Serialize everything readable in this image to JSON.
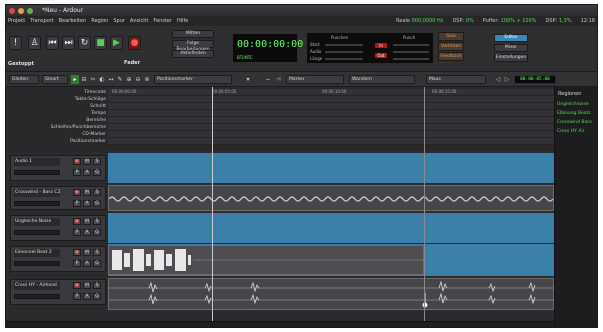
{
  "window": {
    "title": "*Neu - Ardour",
    "traffic_colors": [
      "#e0443e",
      "#e8a33c",
      "#5ab54a"
    ]
  },
  "menu": [
    "Projekt",
    "Transport",
    "Bearbeiten",
    "Region",
    "Spur",
    "Ansicht",
    "Fenster",
    "Hilfe"
  ],
  "status": {
    "items": [
      {
        "label": "Reale",
        "value": "000,0000 Hz"
      },
      {
        "label": "DSP:",
        "value": "0%"
      },
      {
        "label": "Puffer:",
        "value": "100% + 100%"
      },
      {
        "label": "DSP:",
        "value": "1,3%"
      },
      {
        "label": "",
        "value": "12:18"
      }
    ]
  },
  "transport": {
    "buttons": [
      {
        "name": "panic-button",
        "glyph": "!"
      },
      {
        "name": "metronome-button",
        "glyph": "♙"
      },
      {
        "name": "goto-start-button",
        "glyph": "⏮"
      },
      {
        "name": "goto-end-button",
        "glyph": "⏭"
      },
      {
        "name": "loop-button",
        "glyph": "↻"
      },
      {
        "name": "stop-button",
        "glyph": "■"
      },
      {
        "name": "play-button",
        "glyph": "▶"
      },
      {
        "name": "record-button",
        "glyph": "●"
      }
    ],
    "state": "Gestoppt",
    "feder": "Feder",
    "side_buttons": [
      "Mitten",
      "Folge Bearbeitungen",
      "Aktivfinden"
    ],
    "clock": "00:00:00:00",
    "clock_format": "BTI/NTC",
    "meter_headers": [
      "Punchen",
      "Punch"
    ],
    "meter_rows": [
      "Start",
      "Audio",
      "Länge"
    ],
    "meter_buttons": [
      "In",
      "Out"
    ],
    "option_buttons": [
      "Solo",
      "Vorhören",
      "Feedback"
    ],
    "view_buttons": [
      "Editor",
      "Mixer",
      "Einstellungen"
    ]
  },
  "editbar": {
    "mode1": "Gleiten",
    "mode2": "Smart",
    "snap": "Positionsmarker",
    "edit_point": "Marker",
    "nudge_label": "Wandern",
    "zoom_label": "Maus",
    "nudge_clock": "00:00:05:00"
  },
  "rulers": {
    "labels": [
      "Timecode",
      "Takte:Schläge",
      "Schnitt",
      "Tempo",
      "Bereiche",
      "Schleifen/Punchbereiche",
      "CD-Marker",
      "Positionsmarker"
    ],
    "ticks": [
      "00:00:00:00",
      "00:00:05:00",
      "00:00:10:00",
      "00:00:15:00"
    ]
  },
  "tracks": [
    {
      "name": "Audio 1",
      "type": "empty"
    },
    {
      "name": "Crosswind - Bass C2",
      "type": "wave"
    },
    {
      "name": "Ungleiche Noise",
      "type": "empty"
    },
    {
      "name": "Eileonnel Beat 2",
      "type": "beat"
    },
    {
      "name": "Cross HY - Airhead",
      "type": "sparse"
    }
  ],
  "track_buttons": [
    "●",
    "M",
    "S",
    "P",
    "A",
    "G"
  ],
  "sidebar": {
    "title": "Regionen",
    "items": [
      "Ungleichnoise",
      "Elbloung Beats",
      "Crosswind Bass",
      "Cross HY Air"
    ]
  }
}
